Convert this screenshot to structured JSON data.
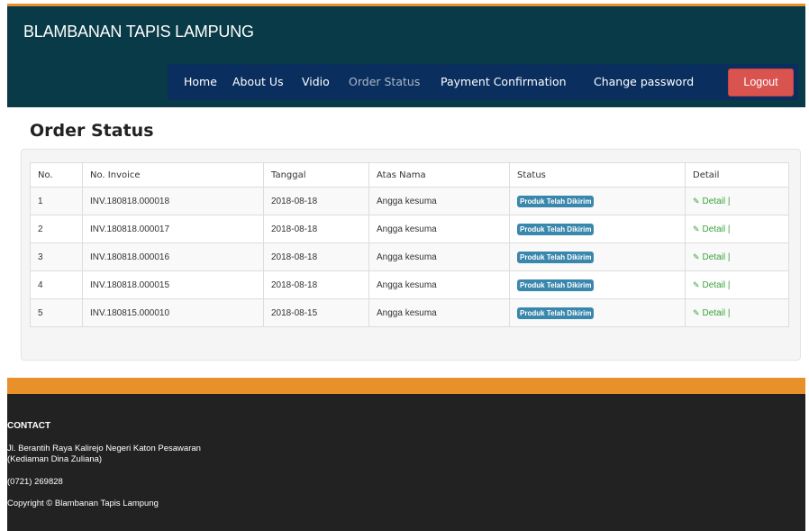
{
  "brand": "BLAMBANAN TAPIS LAMPUNG",
  "nav": {
    "items": [
      {
        "label": "Home",
        "active": false
      },
      {
        "label": "About Us",
        "active": false
      },
      {
        "label": "Vidio",
        "active": false
      },
      {
        "label": "Order Status",
        "active": true
      },
      {
        "label": "Payment Confirmation",
        "active": false
      },
      {
        "label": "Change password",
        "active": false
      }
    ],
    "logout_label": "Logout"
  },
  "page_title": "Order Status",
  "table": {
    "columns": [
      "No.",
      "No. Invoice",
      "Tanggal",
      "Atas Nama",
      "Status",
      "Detail"
    ],
    "rows": [
      {
        "no": "1",
        "invoice": "INV.180818.000018",
        "tanggal": "2018-08-18",
        "atas_nama": "Angga kesuma",
        "status": "Produk Telah Dikirim",
        "detail": "Detail |"
      },
      {
        "no": "2",
        "invoice": "INV.180818.000017",
        "tanggal": "2018-08-18",
        "atas_nama": "Angga kesuma",
        "status": "Produk Telah Dikirim",
        "detail": "Detail |"
      },
      {
        "no": "3",
        "invoice": "INV.180818.000016",
        "tanggal": "2018-08-18",
        "atas_nama": "Angga kesuma",
        "status": "Produk Telah Dikirim",
        "detail": "Detail |"
      },
      {
        "no": "4",
        "invoice": "INV.180818.000015",
        "tanggal": "2018-08-18",
        "atas_nama": "Angga kesuma",
        "status": "Produk Telah Dikirim",
        "detail": "Detail |"
      },
      {
        "no": "5",
        "invoice": "INV.180815.000010",
        "tanggal": "2018-08-15",
        "atas_nama": "Angga kesuma",
        "status": "Produk Telah Dikirim",
        "detail": "Detail |"
      }
    ]
  },
  "footer": {
    "contact_title": "CONTACT",
    "address_line1": "Jl. Berantih Raya Kalirejo Negeri Katon Pesawaran",
    "address_line2": "(Kediaman Dina Zuliana)",
    "phone": "(0721) 269828",
    "copyright": "Copyright © Blambanan Tapis Lampung"
  },
  "colors": {
    "header_bg": "#083a47",
    "nav_bg": "#0a2f5f",
    "accent_orange": "#e8902a",
    "logout_red": "#d9534f",
    "badge_blue": "#3a87ad",
    "detail_green": "#3aa33a",
    "footer_bg": "#222222"
  },
  "icons": {
    "detail": "pencil-icon"
  }
}
